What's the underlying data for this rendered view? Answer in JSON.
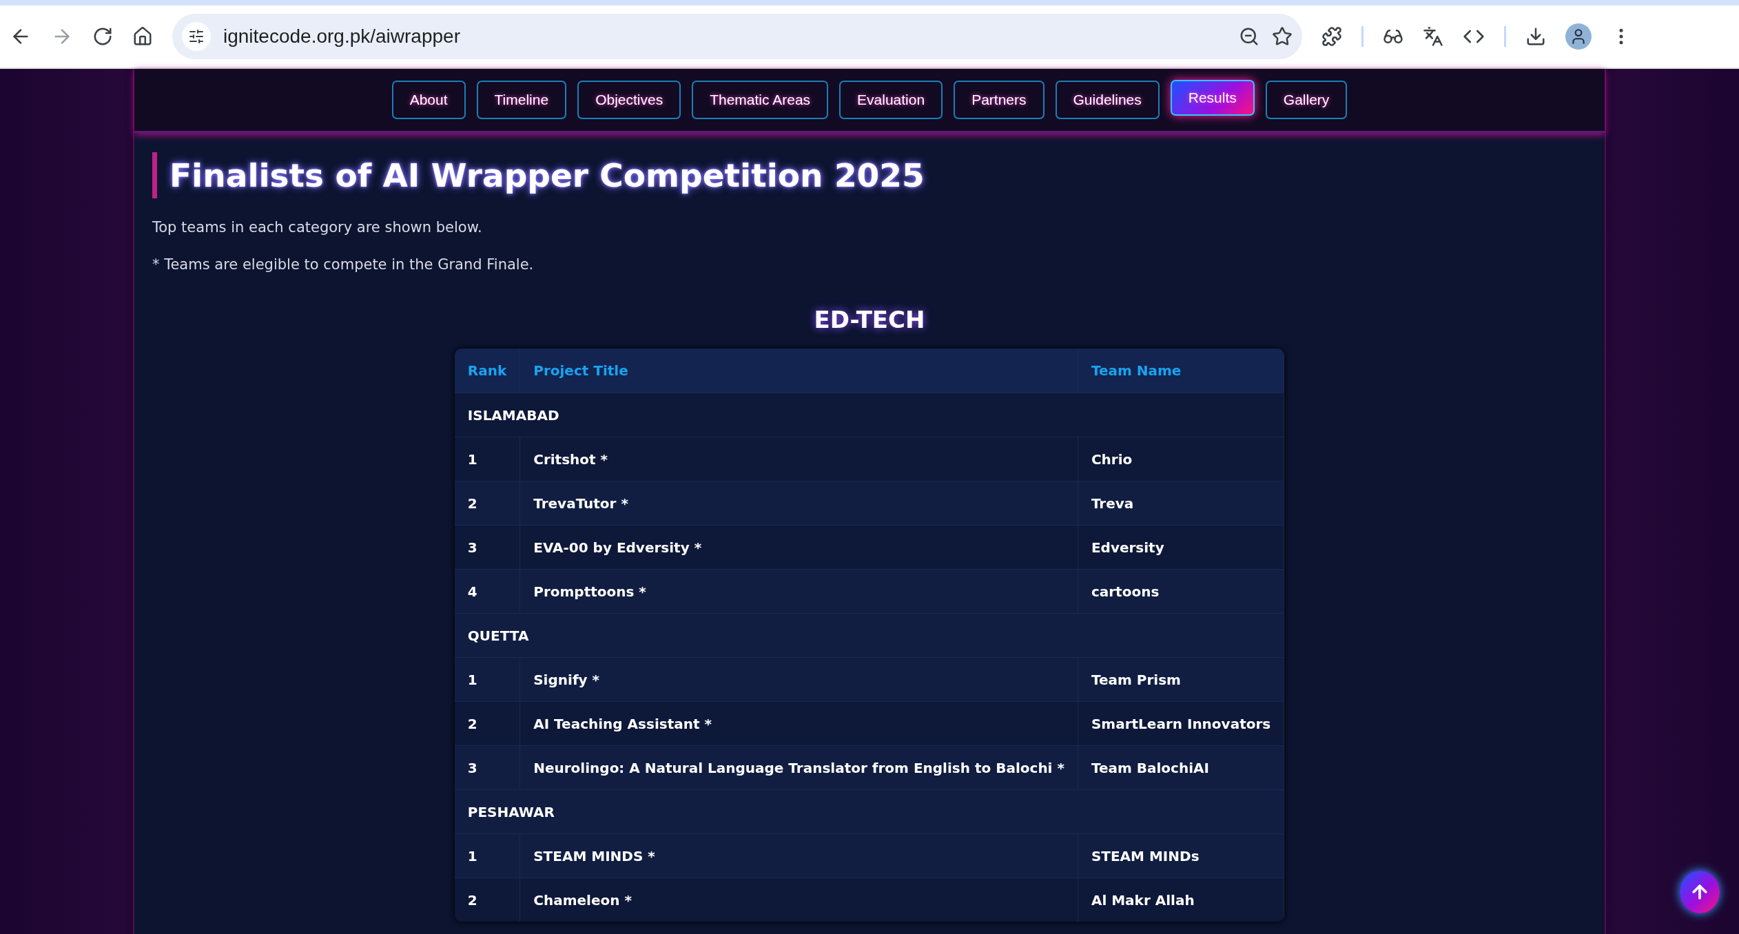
{
  "browser": {
    "url": "ignitecode.org.pk/aiwrapper"
  },
  "nav": [
    {
      "label": "About",
      "selected": false
    },
    {
      "label": "Timeline",
      "selected": false
    },
    {
      "label": "Objectives",
      "selected": false
    },
    {
      "label": "Thematic Areas",
      "selected": false
    },
    {
      "label": "Evaluation",
      "selected": false
    },
    {
      "label": "Partners",
      "selected": false
    },
    {
      "label": "Guidelines",
      "selected": false
    },
    {
      "label": "Results",
      "selected": true
    },
    {
      "label": "Gallery",
      "selected": false
    }
  ],
  "heading": "Finalists of AI Wrapper Competition 2025",
  "intro": [
    "Top teams in each category are shown below.",
    "* Teams are elegible to compete in the Grand Finale."
  ],
  "category": "ED-TECH",
  "table": {
    "columns": [
      "Rank",
      "Project Title",
      "Team Name"
    ],
    "rows": [
      {
        "kind": "group",
        "label": "ISLAMABAD"
      },
      {
        "kind": "entry",
        "rank": "1",
        "title": "Critshot *",
        "team": "Chrio"
      },
      {
        "kind": "entry",
        "rank": "2",
        "title": "TrevaTutor *",
        "team": "Treva"
      },
      {
        "kind": "entry",
        "rank": "3",
        "title": "EVA-00 by Edversity *",
        "team": "Edversity"
      },
      {
        "kind": "entry",
        "rank": "4",
        "title": "Prompttoons *",
        "team": "cartoons"
      },
      {
        "kind": "group",
        "label": "QUETTA"
      },
      {
        "kind": "entry",
        "rank": "1",
        "title": "Signify *",
        "team": "Team Prism"
      },
      {
        "kind": "entry",
        "rank": "2",
        "title": "AI Teaching Assistant *",
        "team": "SmartLearn Innovators"
      },
      {
        "kind": "entry",
        "rank": "3",
        "title": "Neurolingo: A Natural Language Translator from English to Balochi *",
        "team": "Team BalochiAI"
      },
      {
        "kind": "group",
        "label": "PESHAWAR"
      },
      {
        "kind": "entry",
        "rank": "1",
        "title": "STEAM MINDS *",
        "team": "STEAM MINDs"
      },
      {
        "kind": "entry",
        "rank": "2",
        "title": "Chameleon *",
        "team": "Al Makr Allah"
      }
    ]
  }
}
